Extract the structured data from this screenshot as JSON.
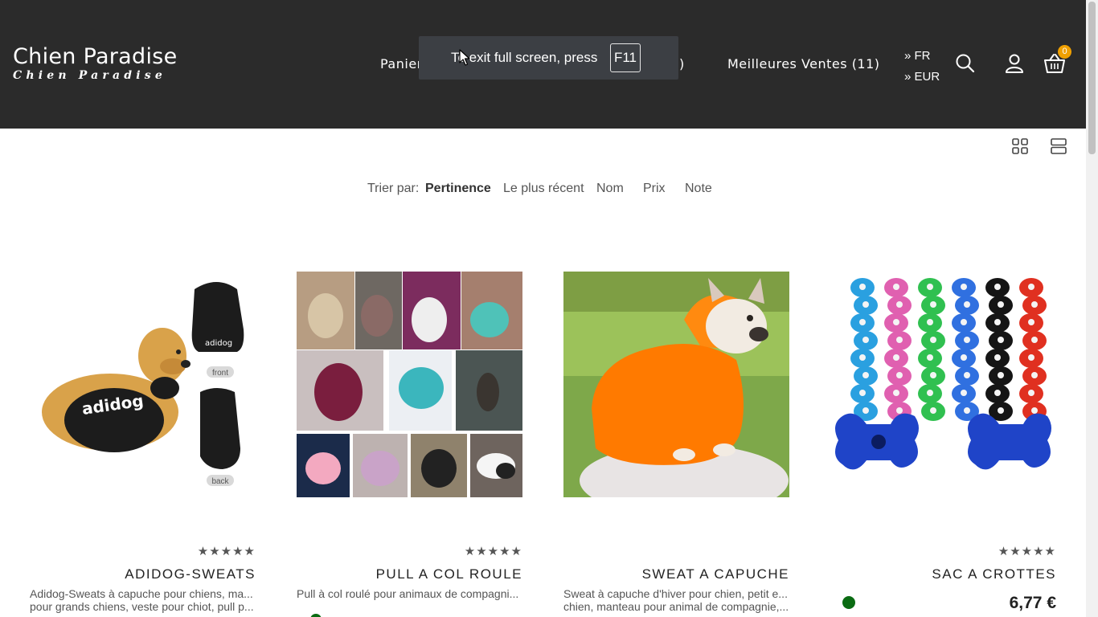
{
  "header": {
    "logo_main": "Chien Paradise",
    "logo_sub": "Chien Paradise",
    "nav": {
      "panier": "Panier",
      "paren": ")",
      "best": "Meilleures Ventes (11)"
    },
    "language": "» FR",
    "currency": "» EUR",
    "cart_count": "0",
    "icons": [
      "search-icon",
      "user-icon",
      "cart-icon"
    ]
  },
  "toast": {
    "text": "To exit full screen, press",
    "key": "F11"
  },
  "sort": {
    "label": "Trier par:",
    "options": [
      "Pertinence",
      "Le plus récent",
      "Nom",
      "Prix",
      "Note"
    ],
    "active": "Pertinence"
  },
  "products": [
    {
      "rating": "★★★★★",
      "title": "ADIDOG-SWEATS",
      "desc_line1": "Adidog-Sweats à capuche pour chiens, ma...",
      "desc_line2": "pour grands chiens, veste pour chiot, pull p...",
      "image_labels": {
        "front": "front",
        "back": "back",
        "brand": "adidog"
      }
    },
    {
      "rating": "★★★★★",
      "title": "PULL A COL ROULE",
      "desc_line1": "Pull à col roulé pour animaux de compagni...",
      "desc_line2": ""
    },
    {
      "rating": "",
      "title": "SWEAT A CAPUCHE",
      "desc_line1": "Sweat à capuche d'hiver pour chien, petit e...",
      "desc_line2": "chien, manteau pour animal de compagnie,..."
    },
    {
      "rating": "★★★★★",
      "title": "SAC A CROTTES",
      "price": "6,77 €"
    }
  ],
  "colors": {
    "header_bg": "#2b2b2b",
    "badge": "#f0a000",
    "stock_green": "#0a6b12"
  }
}
